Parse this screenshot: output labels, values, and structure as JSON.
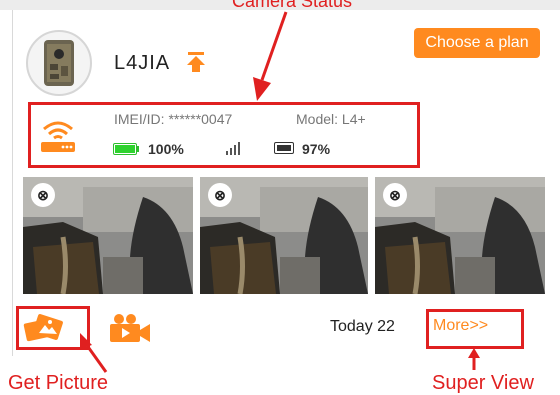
{
  "annotations": {
    "top_label": "Camera Status",
    "get_picture": "Get Picture",
    "super_view": "Super View",
    "color": "#e02020"
  },
  "camera": {
    "name": "L4JIA",
    "name_icon": "upgrade-arrow-icon",
    "plan_button": "Choose a plan",
    "imei": "IMEI/ID: ******0047",
    "model": "Model: L4+",
    "battery_level": 1.0,
    "battery": "100%",
    "signal_icon": "signal-bars-icon",
    "sd_icon": "sd-card-icon",
    "storage": "97%",
    "status_icon": "wifi-router-icon"
  },
  "thumbnails": [
    {
      "badge_icon": "remove-icon"
    },
    {
      "badge_icon": "remove-icon"
    },
    {
      "badge_icon": "remove-icon"
    }
  ],
  "footer": {
    "get_picture_icon": "get-picture-icon",
    "video_icon": "video-camera-icon",
    "today": "Today 22",
    "more": "More>>"
  },
  "colors": {
    "accent": "#ff8a1f",
    "battery": "#2ed22e",
    "highlight": "#e02020"
  }
}
